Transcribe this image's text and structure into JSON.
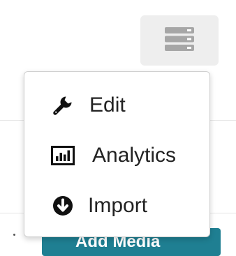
{
  "toolbar": {
    "menu_icon": "server-stack-icon"
  },
  "dropdown": {
    "items": [
      {
        "label": "Edit",
        "icon": "wrench-icon"
      },
      {
        "label": "Analytics",
        "icon": "bar-chart-icon"
      },
      {
        "label": "Import",
        "icon": "arrow-circle-down-icon"
      }
    ]
  },
  "background": {
    "button_label": "Add Media"
  },
  "colors": {
    "menu_toggle_bg": "#eeeeee",
    "icon_gray": "#a6a6a6",
    "text": "#222222",
    "accent_teal": "#1f7f92"
  }
}
